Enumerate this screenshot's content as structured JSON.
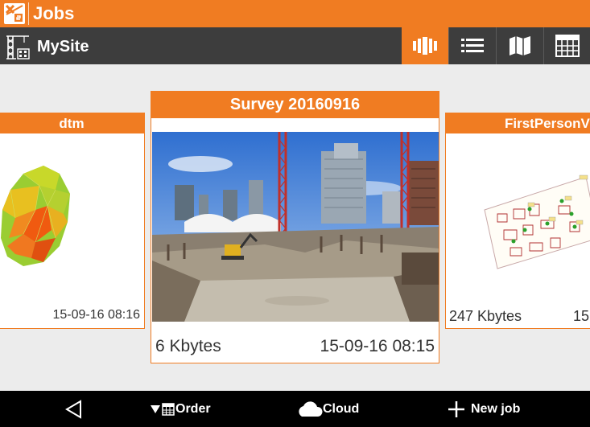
{
  "app": {
    "title": "Jobs"
  },
  "site": {
    "name": "MySite"
  },
  "view_modes": [
    {
      "name": "carousel-view",
      "active": true
    },
    {
      "name": "list-view",
      "active": false
    },
    {
      "name": "map-view",
      "active": false
    },
    {
      "name": "grid-view",
      "active": false
    }
  ],
  "jobs": [
    {
      "title": "dtm",
      "size": "",
      "date": "15-09-16 08:16",
      "thumbnail": "terrain-model-icon"
    },
    {
      "title": "Survey 20160916",
      "size": "6 Kbytes",
      "date": "15-09-16 08:15",
      "thumbnail": "construction-site-photo"
    },
    {
      "title": "FirstPersonV",
      "size": "247 Kbytes",
      "date": "15",
      "thumbnail": "site-plan-map"
    }
  ],
  "bottom_bar": {
    "order_label": "Order",
    "cloud_label": "Cloud",
    "new_job_label": "New job"
  },
  "colors": {
    "accent": "#f07c22",
    "dark_bar": "#3d3d3d",
    "background": "#ececec"
  }
}
